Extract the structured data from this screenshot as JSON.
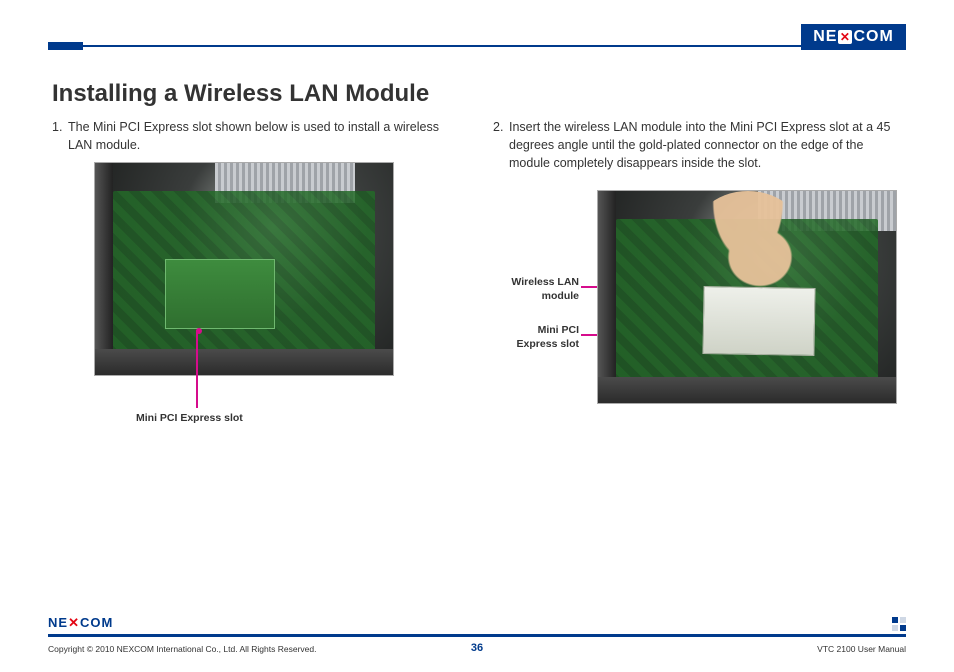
{
  "brand": {
    "name": "NE✕COM",
    "text_left": "NE",
    "text_x": "✕",
    "text_right": "COM"
  },
  "heading": "Installing a Wireless LAN Module",
  "steps": [
    {
      "num": "1.",
      "text": "The Mini PCI Express slot shown below is used to install a wireless LAN module."
    },
    {
      "num": "2.",
      "text": "Insert the wireless LAN module into the Mini PCI Express slot at a 45 degrees angle until the gold-plated connector on the edge of the module completely disappears inside the slot."
    }
  ],
  "callouts": {
    "fig1_slot": "Mini PCI Express slot",
    "fig2_module_line1": "Wireless LAN",
    "fig2_module_line2": "module",
    "fig2_slot_line1": "Mini PCI",
    "fig2_slot_line2": "Express slot"
  },
  "footer": {
    "copyright": "Copyright © 2010 NEXCOM International Co., Ltd. All Rights Reserved.",
    "page": "36",
    "doc": "VTC 2100 User Manual"
  }
}
